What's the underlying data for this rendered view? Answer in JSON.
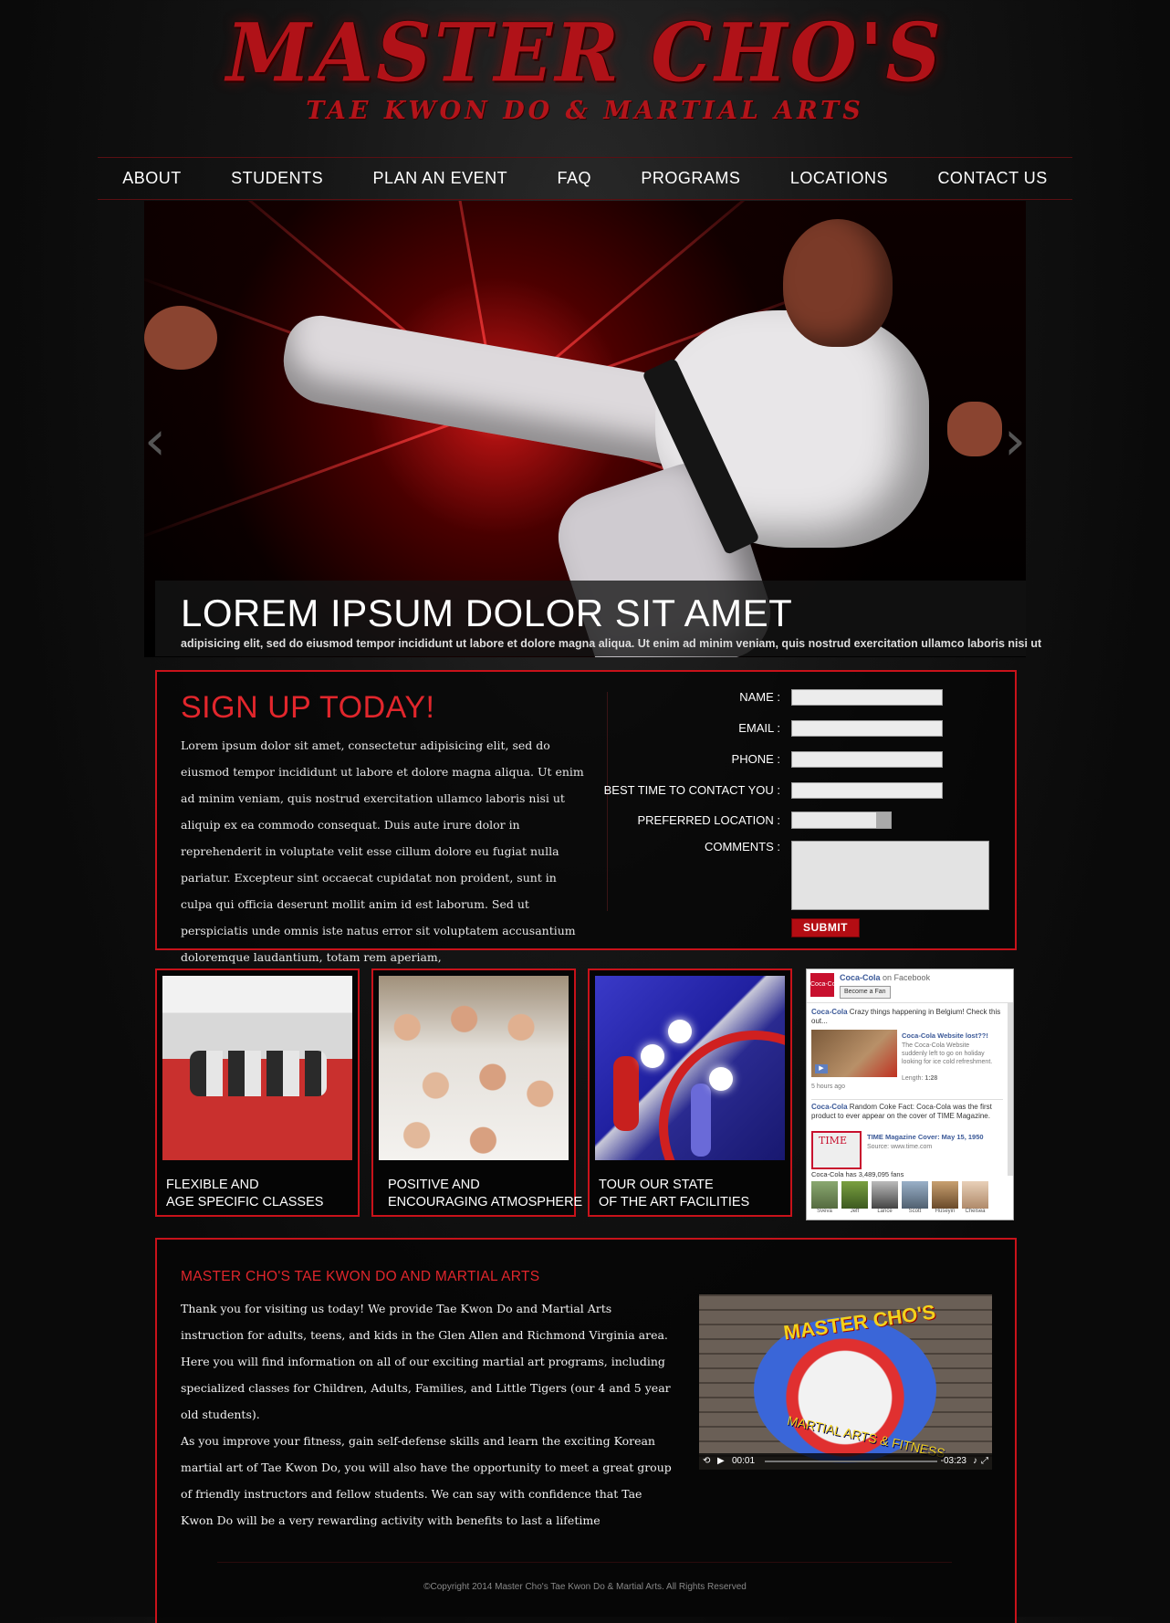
{
  "brand": {
    "title": "MASTER CHO'S",
    "subtitle": "TAE KWON DO & MARTIAL ARTS",
    "accent_color": "#c8121a"
  },
  "nav": {
    "items": [
      "ABOUT",
      "STUDENTS",
      "PLAN AN EVENT",
      "FAQ",
      "PROGRAMS",
      "LOCATIONS",
      "CONTACT US"
    ]
  },
  "hero": {
    "title": "LOREM IPSUM DOLOR SIT AMET",
    "subtitle": "adipisicing elit, sed do eiusmod tempor incididunt ut labore et dolore magna aliqua. Ut enim ad minim veniam, quis nostrud exercitation ullamco laboris nisi ut",
    "prev_icon": "chevron-left-icon",
    "next_icon": "chevron-right-icon"
  },
  "signup": {
    "title": "SIGN UP TODAY!",
    "text": "Lorem ipsum dolor sit amet, consectetur adipisicing elit, sed do eiusmod tempor incididunt ut labore et dolore magna aliqua. Ut enim ad minim veniam, quis nostrud exercitation ullamco laboris nisi ut aliquip ex ea commodo consequat. Duis aute irure dolor in reprehenderit in voluptate velit esse cillum dolore eu fugiat nulla pariatur. Excepteur sint occaecat cupidatat non proident, sunt in culpa qui officia deserunt mollit anim id est laborum. Sed ut perspiciatis unde omnis iste natus error sit voluptatem accusantium doloremque laudantium, totam rem aperiam,",
    "labels": {
      "name": "NAME :",
      "email": "EMAIL :",
      "phone": "PHONE :",
      "best_time": "BEST TIME TO CONTACT YOU :",
      "location": "PREFERRED LOCATION :",
      "comments": "COMMENTS :"
    },
    "submit_label": "SUBMIT"
  },
  "features": [
    {
      "line1": "FLEXIBLE AND",
      "line2": "AGE SPECIFIC CLASSES"
    },
    {
      "line1": "POSITIVE AND",
      "line2": "ENCOURAGING ATMOSPHERE"
    },
    {
      "line1": "TOUR OUR STATE",
      "line2": "OF THE ART FACILITIES"
    }
  ],
  "facebook": {
    "page_name": "Coca-Cola",
    "on_text": "on Facebook",
    "fan_button": "Become a Fan",
    "post1_author": "Coca-Cola",
    "post1_text": "Crazy things happening in Belgium! Check this out...",
    "post1_link_title": "Coca-Cola Website lost??!",
    "post1_link_desc": "The Coca-Cola Website suddenly left to go on holiday looking for ice cold refreshment.",
    "post1_length_label": "Length:",
    "post1_length": "1:28",
    "post1_time": "5 hours ago",
    "post2_author": "Coca-Cola",
    "post2_text": "Random Coke Fact: Coca-Cola was the first product to ever appear on the cover of TIME Magazine.",
    "post2_link_title": "TIME Magazine Cover: May 15, 1950",
    "post2_link_source": "Source: www.time.com",
    "thumb_label": "TIME",
    "fans_count": "Coca-Cola has 3,489,095 fans",
    "fans": [
      "Sveva",
      "Jeff",
      "Lance",
      "Scott",
      "Hüseyin",
      "Chelsea"
    ]
  },
  "about": {
    "title": "MASTER CHO'S TAE KWON DO AND MARTIAL ARTS",
    "p1": "Thank you for visiting us today! We provide Tae Kwon Do and Martial Arts instruction for adults, teens, and kids in the Glen Allen and Richmond Virginia area. Here you will find information on all of our exciting martial art programs, including specialized classes for Children, Adults, Families, and Little Tigers (our 4 and 5 year old students).",
    "p2": "As you improve your fitness, gain self-defense skills and learn the exciting Korean martial art of Tae Kwon Do, you will also have the opportunity to meet a great group of friendly instructors and fellow students. We can say with confidence that Tae Kwon Do will be a very rewarding activity with benefits to last a lifetime"
  },
  "video": {
    "badge_top": "MASTER CHO'S",
    "badge_bottom": "MARTIAL ARTS & FITNESS",
    "elapsed": "00:01",
    "remaining": "-03:23",
    "icons": [
      "replay-icon",
      "play-icon",
      "volume-icon",
      "fullscreen-icon"
    ]
  },
  "footer": {
    "copyright": "©Copyright 2014 Master Cho's Tae Kwon Do & Martial Arts. All Rights Reserved"
  }
}
